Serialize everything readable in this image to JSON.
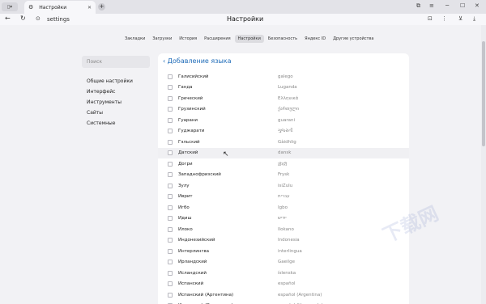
{
  "browser": {
    "tab_title": "Настройки",
    "url": "settings",
    "page_title": "Настройки"
  },
  "topnav": [
    {
      "label": "Закладки",
      "active": false
    },
    {
      "label": "Загрузки",
      "active": false
    },
    {
      "label": "История",
      "active": false
    },
    {
      "label": "Расширения",
      "active": false
    },
    {
      "label": "Настройки",
      "active": true
    },
    {
      "label": "Безопасность",
      "active": false
    },
    {
      "label": "Яндекс ID",
      "active": false
    },
    {
      "label": "Другие устройства",
      "active": false
    }
  ],
  "sidebar": {
    "search_placeholder": "Поиск",
    "items": [
      {
        "label": "Общие настройки"
      },
      {
        "label": "Интерфейс"
      },
      {
        "label": "Инструменты"
      },
      {
        "label": "Сайты"
      },
      {
        "label": "Системные"
      }
    ]
  },
  "panel": {
    "title": "Добавление языка",
    "languages": [
      {
        "name": "Галисийский",
        "native": "galego"
      },
      {
        "name": "Ганда",
        "native": "Luganda"
      },
      {
        "name": "Греческий",
        "native": "Ελληνικά"
      },
      {
        "name": "Грузинский",
        "native": "ქართული"
      },
      {
        "name": "Гуарани",
        "native": "guarani"
      },
      {
        "name": "Гуджарати",
        "native": "ગુજરાતી"
      },
      {
        "name": "Гэльский",
        "native": "Gàidhlig"
      },
      {
        "name": "Датский",
        "native": "dansk"
      },
      {
        "name": "Догри",
        "native": "डोगरी"
      },
      {
        "name": "Западнофризский",
        "native": "Frysk"
      },
      {
        "name": "Зулу",
        "native": "isiZulu"
      },
      {
        "name": "Иврит",
        "native": "עברית"
      },
      {
        "name": "Игбо",
        "native": "Igbo"
      },
      {
        "name": "Идиш",
        "native": "ייִדיש"
      },
      {
        "name": "Илоко",
        "native": "Ilokano"
      },
      {
        "name": "Индонезийский",
        "native": "Indonesia"
      },
      {
        "name": "Интерлингва",
        "native": "interlingua"
      },
      {
        "name": "Ирландский",
        "native": "Gaeilge"
      },
      {
        "name": "Исландский",
        "native": "íslenska"
      },
      {
        "name": "Испанский",
        "native": "español"
      },
      {
        "name": "Испанский (Аргентина)",
        "native": "español (Argentina)"
      },
      {
        "name": "Испанский (Венесуэла)",
        "native": "español (Venezuela)"
      }
    ]
  },
  "colors": {
    "accent": "#1e6bb8",
    "highlight_row": "#f0f0f3"
  },
  "hovered_row_index": 7
}
